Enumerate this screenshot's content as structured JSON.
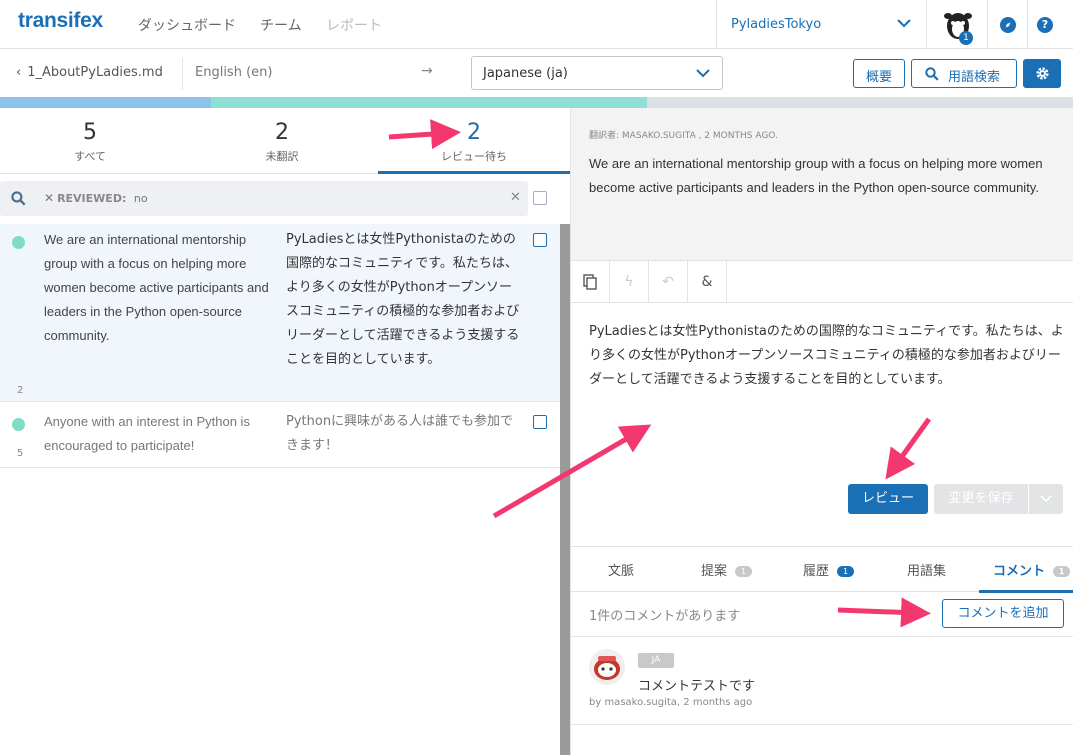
{
  "colors": {
    "brand": "#1a6fb5",
    "reviewed_progress": "#8cc3ea",
    "translated_progress": "#8fe0d4",
    "untranslated_progress": "#dcdfe6",
    "annotation_arrow": "#f2386f",
    "status_dot": "#7fdcc8"
  },
  "nav": {
    "logo": "transifex",
    "links": [
      "ダッシュボード",
      "チーム",
      "レポート"
    ],
    "org_name": "PyladiesTokyo",
    "notification_count": "1",
    "icons": [
      "chevron-down-icon",
      "avatar-icon",
      "compass-icon",
      "help-icon"
    ]
  },
  "toolbar": {
    "back_file": "1_AboutPyLadies.md",
    "source_lang": "English (en)",
    "arrow": "→",
    "target_lang": "Japanese (ja)",
    "overview_label": "概要",
    "glossary_search_label": "用語検索"
  },
  "progress": {
    "reviewed_fraction": 0.197,
    "translated_fraction": 0.406
  },
  "stats": [
    {
      "count": "5",
      "label": "すべて"
    },
    {
      "count": "2",
      "label": "未翻訳"
    },
    {
      "count": "2",
      "label": "レビュー待ち"
    }
  ],
  "filter": {
    "tag_key": "REVIEWED:",
    "tag_value": "no"
  },
  "strings": [
    {
      "id": "2",
      "source": "We are an international mentorship group with a focus on helping more women become active participants and leaders in the Python open-source community.",
      "translation": "PyLadiesとは女性Pythonistaのための国際的なコミュニティです。私たちは、より多くの女性がPythonオープンソースコミュニティの積極的な参加者およびリーダーとして活躍できるよう支援することを目的としています。"
    },
    {
      "id": "5",
      "source": "Anyone with an interest in Python is encouraged to participate!",
      "translation": "Pythonに興味がある人は誰でも参加できます！"
    }
  ],
  "detail": {
    "translator_line": "翻訳者: MASAKO.SUGITA , 2 MONTHS AGO.",
    "source_text": "We are an international mentorship group with a focus on helping more women become active participants and leaders in the Python open-source community.",
    "target_text": "PyLadiesとは女性Pythonistaのための国際的なコミュニティです。私たちは、より多くの女性がPythonオープンソースコミュニティの積極的な参加者およびリーダーとして活躍できるよう支援することを目的としています。",
    "tool_icons": [
      "copy-icon",
      "bolt-icon",
      "undo-icon",
      "ampersand-icon"
    ],
    "review_button": "レビュー",
    "save_button": "変更を保存"
  },
  "tabs": [
    {
      "label": "文脈",
      "badge": ""
    },
    {
      "label": "提案",
      "badge": "1"
    },
    {
      "label": "履歴",
      "badge": "1"
    },
    {
      "label": "用語集",
      "badge": ""
    },
    {
      "label": "コメント",
      "badge": "1"
    }
  ],
  "comments": {
    "count_text": "1件のコメントがあります",
    "add_button": "コメントを追加",
    "items": [
      {
        "lang": "JA",
        "text": "コメントテストです",
        "meta": "by masako.sugita, 2 months ago"
      }
    ]
  }
}
